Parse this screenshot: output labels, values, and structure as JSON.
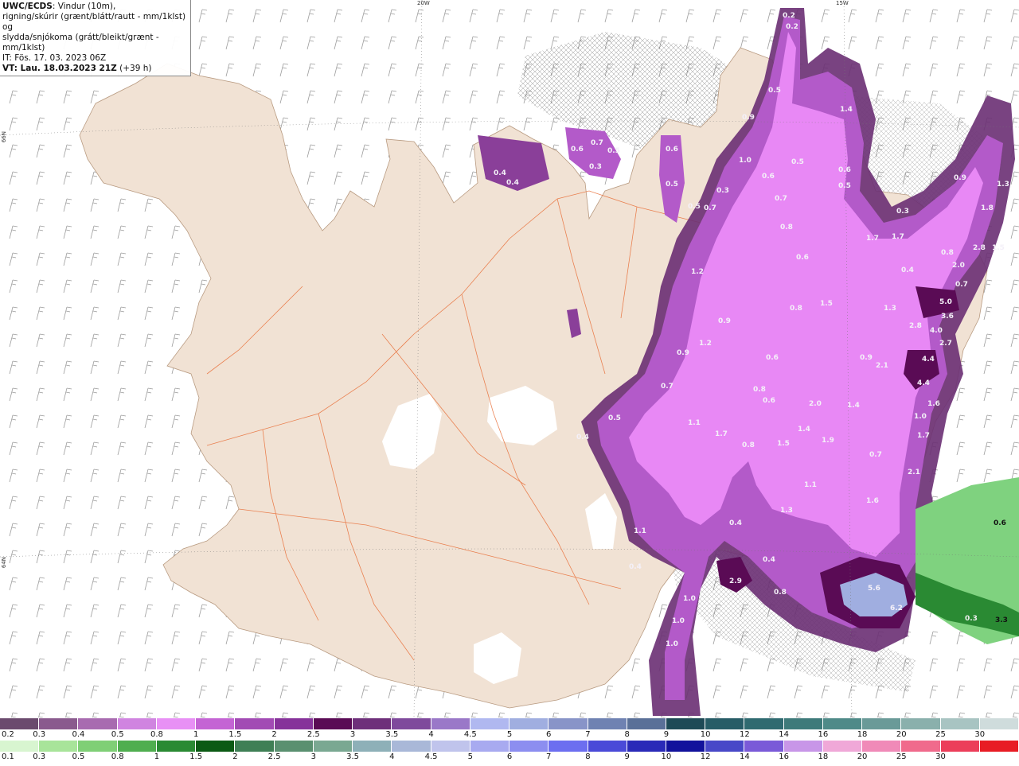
{
  "info": {
    "line1_bold": "UWC/ECDS",
    "line1_rest": ": Vindur (10m),",
    "line2": "rigning/skúrir (grænt/blátt/rautt - mm/1klst) og",
    "line3": "slydda/snjókoma (grátt/bleikt/grænt - mm/1klst)",
    "line4": "IT: Fös. 17. 03. 2023 06Z",
    "line5_bold": "VT: Lau. 18.03.2023 21Z",
    "line5_rest": " (+39 h)"
  },
  "graticule": {
    "lon_labels": [
      "20W",
      "15W"
    ],
    "lat_labels": [
      "66N",
      "64N"
    ]
  },
  "colors": {
    "land": "#f1e2d4",
    "sea": "#ffffff",
    "roads": "#e8703a",
    "snow_light": "#e888f5",
    "snow_mid": "#b35ac9",
    "snow_dark": "#6a2f73",
    "rain_green": "#7fd27f"
  },
  "precip_values": {
    "northeast": [
      "0.2",
      "0.2",
      "0.5",
      "0.9",
      "1.0",
      "0.6",
      "0.5",
      "1.4",
      "0.6",
      "0.5",
      "0.7",
      "0.8",
      "0.3",
      "0.7",
      "0.6",
      "0.5"
    ],
    "north": [
      "0.6",
      "0.7",
      "0.5",
      "0.3",
      "0.4",
      "0.4",
      "0.6",
      "0.5"
    ],
    "east": [
      "1.7",
      "1.7",
      "1.3",
      "2.8",
      "4.0",
      "3.6",
      "2.7",
      "5.0",
      "0.9",
      "2.1",
      "4.4",
      "4.4",
      "1.6",
      "1.0",
      "1.7",
      "2.1",
      "0.7",
      "1.6",
      "0.4",
      "2.0",
      "2.8",
      "1.5",
      "1.8",
      "1.3",
      "0.9",
      "0.3",
      "0.8",
      "0.7"
    ],
    "central": [
      "1.2",
      "0.9",
      "1.2",
      "0.9",
      "0.7",
      "0.6",
      "0.8",
      "0.6",
      "0.8",
      "2.0",
      "1.4",
      "1.9",
      "1.5",
      "1.4",
      "0.8",
      "1.7",
      "1.1",
      "0.5",
      "0.4",
      "1.1",
      "1.5",
      "1.3",
      "0.4",
      "0.4"
    ],
    "south": [
      "2.9",
      "0.8",
      "5.6",
      "6.2",
      "1.0",
      "1.0",
      "1.0",
      "0.4",
      "1.1"
    ],
    "rain": [
      "0.6",
      "0.3",
      "3.3"
    ]
  },
  "legend": {
    "snow_row": {
      "colors": [
        "#6b4a6e",
        "#8a5a8e",
        "#a86bb0",
        "#d084e0",
        "#e890f5",
        "#c464d4",
        "#a24bb4",
        "#86329a",
        "#5a0b55",
        "#6e2f7a",
        "#7f4a9c",
        "#9a78c8",
        "#b0b8f0",
        "#a0aee0",
        "#8894c8",
        "#6f82b2",
        "#5a7098",
        "#1e4a56",
        "#275c66",
        "#2f6a70",
        "#3e7a7a",
        "#4f8a88",
        "#6a9a98",
        "#8ab0ac",
        "#a8c4c2",
        "#cfdcdc"
      ],
      "labels": [
        "0.2",
        "0.3",
        "0.4",
        "0.5",
        "0.8",
        "1",
        "1.5",
        "2",
        "2.5",
        "3",
        "3.5",
        "4",
        "4.5",
        "5",
        "6",
        "7",
        "8",
        "9",
        "10",
        "12",
        "14",
        "16",
        "18",
        "20",
        "25",
        "30"
      ]
    },
    "rain_row": {
      "colors": [
        "#d8f5d0",
        "#a8e49a",
        "#7fcf76",
        "#4fae4f",
        "#2a8a33",
        "#0b5a14",
        "#3f7f55",
        "#5a9070",
        "#7aa892",
        "#8eb0b8",
        "#a9b8d8",
        "#c0c4ec",
        "#a8aaf0",
        "#8c8ef0",
        "#6c6ef0",
        "#4a4ad8",
        "#2a2ab8",
        "#12129c",
        "#4848c8",
        "#7a5ad8",
        "#c896e8",
        "#f0a8d8",
        "#f08ab8",
        "#f06a8c",
        "#ec3e5a",
        "#e81c24"
      ],
      "labels": [
        "0.1",
        "0.3",
        "0.5",
        "0.8",
        "1",
        "1.5",
        "2",
        "2.5",
        "3",
        "3.5",
        "4",
        "4.5",
        "5",
        "6",
        "7",
        "8",
        "9",
        "10",
        "12",
        "14",
        "16",
        "18",
        "20",
        "25",
        "30"
      ]
    }
  }
}
